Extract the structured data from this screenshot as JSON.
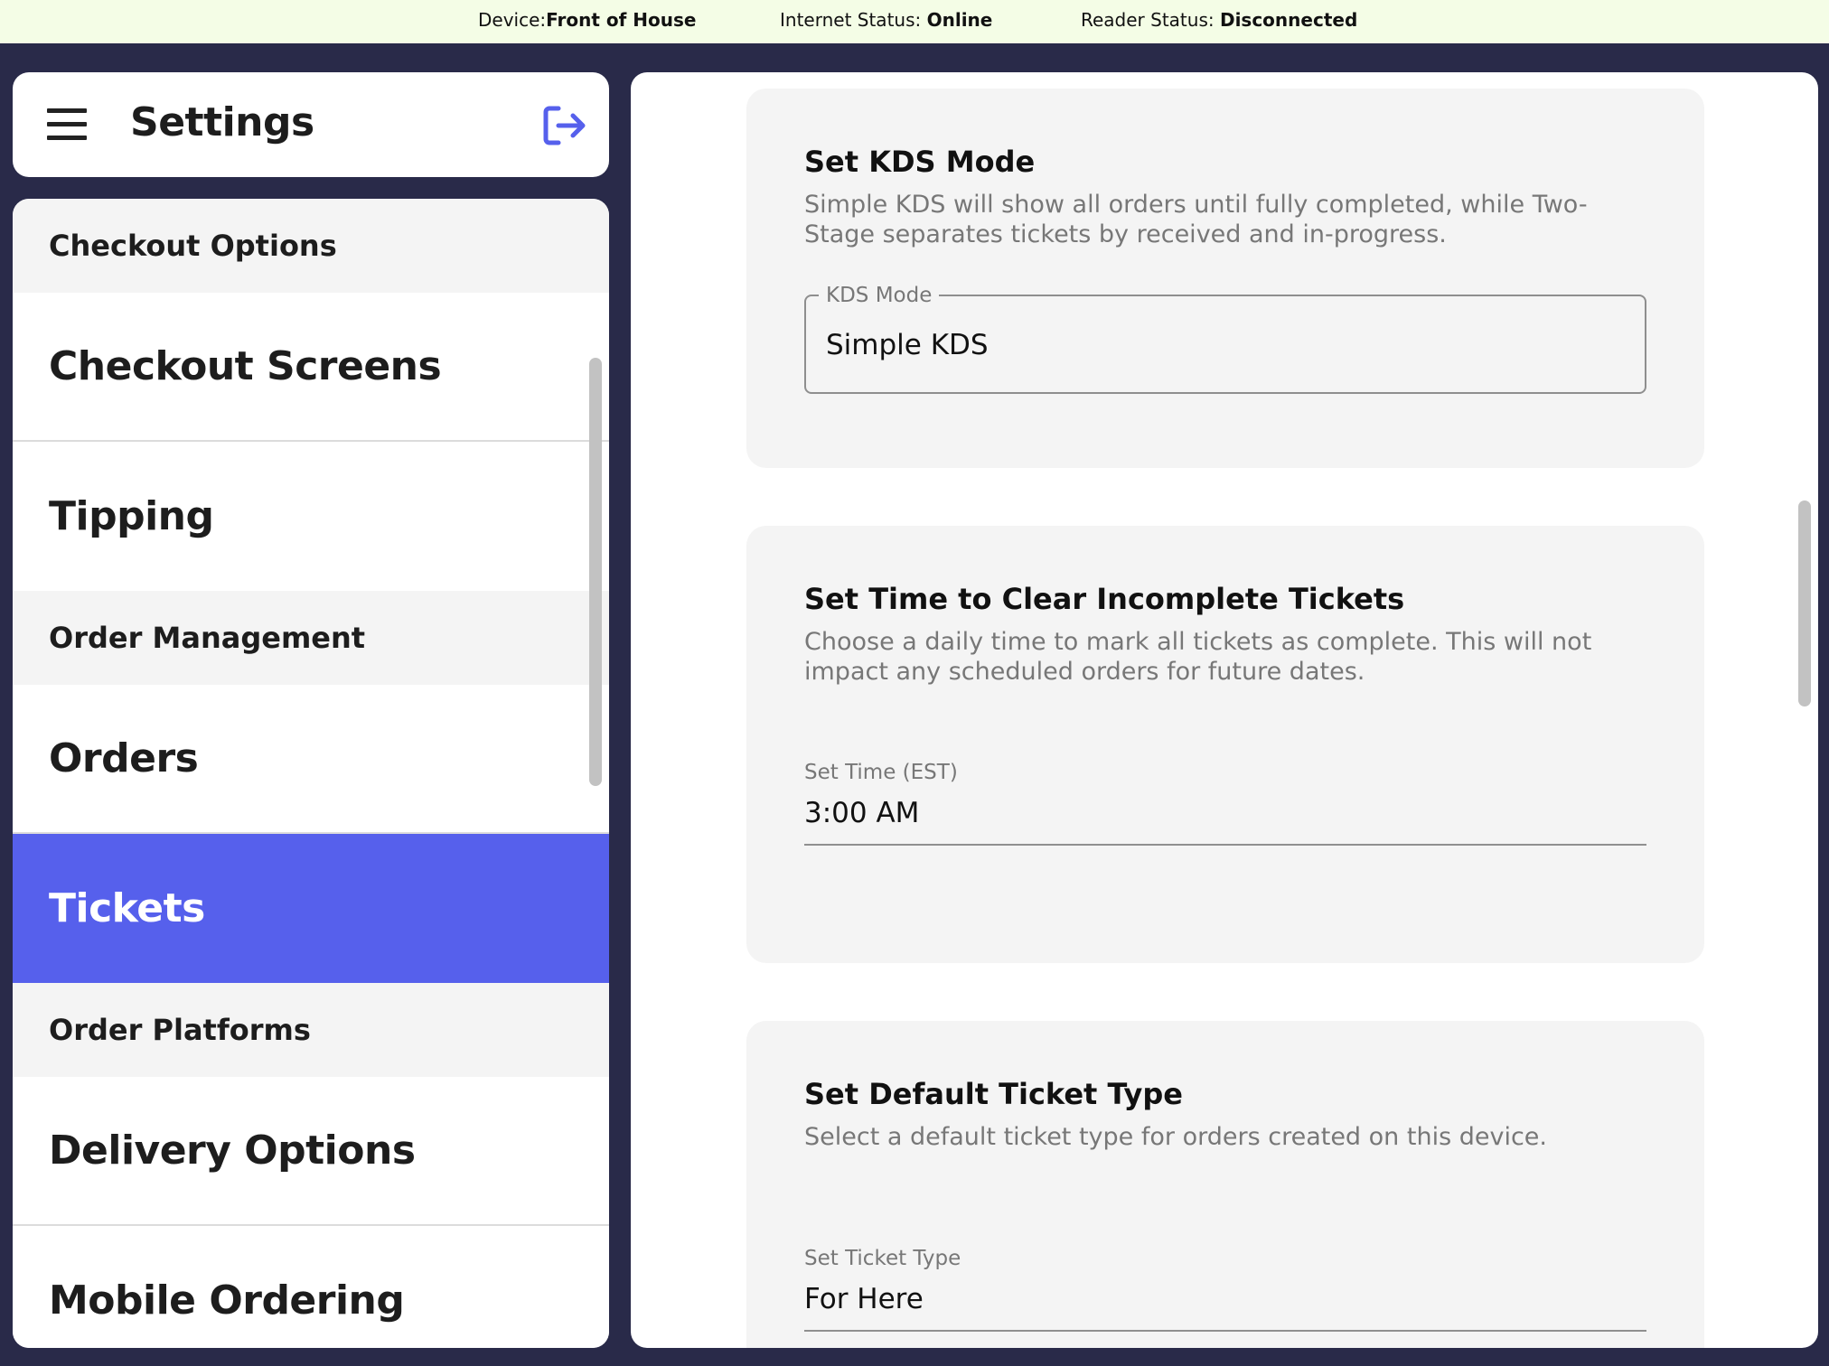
{
  "status_bar": {
    "device_label": "Device:",
    "device_value": "Front of House",
    "internet_label": "Internet Status: ",
    "internet_value": "Online",
    "reader_label": "Reader Status: ",
    "reader_value": "Disconnected"
  },
  "header": {
    "title": "Settings",
    "menu_icon": "hamburger-menu-icon",
    "logout_icon": "logout-icon"
  },
  "nav": {
    "items": [
      {
        "type": "section",
        "label": "Checkout Options"
      },
      {
        "type": "item",
        "label": "Checkout Screens"
      },
      {
        "type": "item",
        "label": "Tipping"
      },
      {
        "type": "section",
        "label": "Order Management"
      },
      {
        "type": "item",
        "label": "Orders"
      },
      {
        "type": "item",
        "label": "Tickets",
        "active": true
      },
      {
        "type": "section",
        "label": "Order Platforms"
      },
      {
        "type": "item",
        "label": "Delivery Options"
      },
      {
        "type": "item",
        "label": "Mobile Ordering"
      }
    ]
  },
  "content": {
    "kds": {
      "title": "Set KDS Mode",
      "description": "Simple KDS will show all orders until fully completed, while Two-Stage separates tickets by received and in-progress.",
      "field_label": "KDS Mode",
      "field_value": "Simple KDS"
    },
    "clear_time": {
      "title": "Set Time to Clear Incomplete Tickets",
      "description": "Choose a daily time to mark all tickets as complete. This will not impact any scheduled orders for future dates.",
      "field_label": "Set Time (EST)",
      "field_value": "3:00 AM"
    },
    "ticket_type": {
      "title": "Set Default Ticket Type",
      "description": "Select a default ticket type for orders created on this device.",
      "field_label": "Set Ticket Type",
      "field_value": "For Here"
    }
  },
  "colors": {
    "accent": "#5660ec",
    "background": "#292a49",
    "status_bar": "#f4fde6"
  }
}
